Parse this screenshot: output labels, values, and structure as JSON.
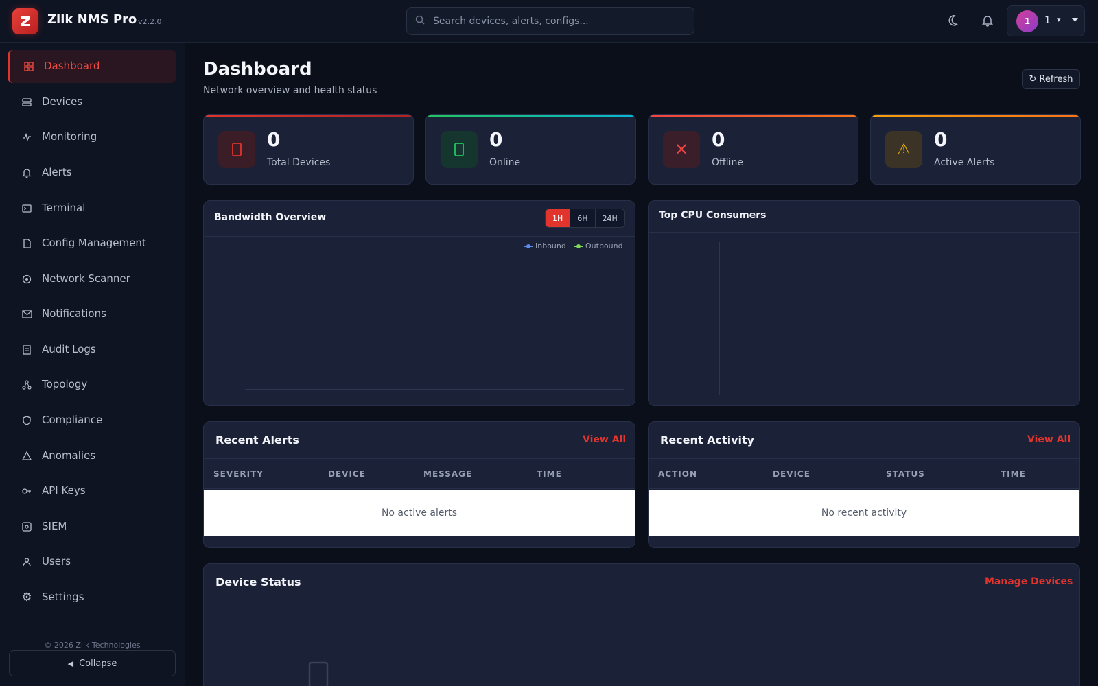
{
  "app": {
    "title": "Zilk NMS Pro",
    "version": "v2.2.0"
  },
  "search": {
    "placeholder": "Search devices, alerts, configs..."
  },
  "user": {
    "avatar_initial": "1",
    "name": "1",
    "caret": "▾"
  },
  "sidebar": {
    "items": [
      {
        "label": "Dashboard",
        "icon": "dashboard-icon",
        "active": true
      },
      {
        "label": "Devices",
        "icon": "devices-icon"
      },
      {
        "label": "Monitoring",
        "icon": "monitoring-icon"
      },
      {
        "label": "Alerts",
        "icon": "bell-icon"
      },
      {
        "label": "Terminal",
        "icon": "terminal-icon"
      },
      {
        "label": "Config Management",
        "icon": "config-icon"
      },
      {
        "label": "Network Scanner",
        "icon": "scanner-icon"
      },
      {
        "label": "Notifications",
        "icon": "envelope-icon"
      },
      {
        "label": "Audit Logs",
        "icon": "audit-icon"
      },
      {
        "label": "Topology",
        "icon": "topology-icon"
      },
      {
        "label": "Compliance",
        "icon": "compliance-icon"
      },
      {
        "label": "Anomalies",
        "icon": "anomalies-icon"
      },
      {
        "label": "API Keys",
        "icon": "key-icon"
      },
      {
        "label": "SIEM",
        "icon": "siem-icon"
      },
      {
        "label": "Users",
        "icon": "users-icon"
      },
      {
        "label": "Settings",
        "icon": "gear-icon"
      }
    ],
    "copyright": "© 2026 Zilk Technologies",
    "collapse_label": "Collapse"
  },
  "header": {
    "title": "Dashboard",
    "subtitle": "Network overview and health status",
    "refresh_label": "Refresh"
  },
  "stats": [
    {
      "value": "0",
      "label": "Total Devices",
      "icon": "server-icon",
      "accent": "#e0342c"
    },
    {
      "value": "0",
      "label": "Online",
      "icon": "check-circle-icon",
      "accent": "#22c55e"
    },
    {
      "value": "0",
      "label": "Offline",
      "icon": "close-icon",
      "accent": "#ef4444"
    },
    {
      "value": "0",
      "label": "Active Alerts",
      "icon": "warning-icon",
      "accent": "#f59e0b"
    }
  ],
  "bandwidth": {
    "title": "Bandwidth Overview",
    "ranges": [
      "1H",
      "6H",
      "24H"
    ],
    "selected_range": "1H",
    "legend": [
      {
        "name": "Inbound",
        "color": "#5b8def"
      },
      {
        "name": "Outbound",
        "color": "#7ed957"
      }
    ]
  },
  "cpu": {
    "title": "Top CPU Consumers"
  },
  "recent_alerts": {
    "title": "Recent Alerts",
    "view_all": "View All",
    "columns": [
      "SEVERITY",
      "DEVICE",
      "MESSAGE",
      "TIME"
    ],
    "empty": "No active alerts"
  },
  "recent_activity": {
    "title": "Recent Activity",
    "view_all": "View All",
    "columns": [
      "ACTION",
      "DEVICE",
      "STATUS",
      "TIME"
    ],
    "empty": "No recent activity"
  },
  "device_status": {
    "title": "Device Status",
    "manage_label": "Manage Devices"
  },
  "colors": {
    "accent": "#e0342c",
    "background": "#0b0f1a",
    "panel": "#1b2136"
  }
}
